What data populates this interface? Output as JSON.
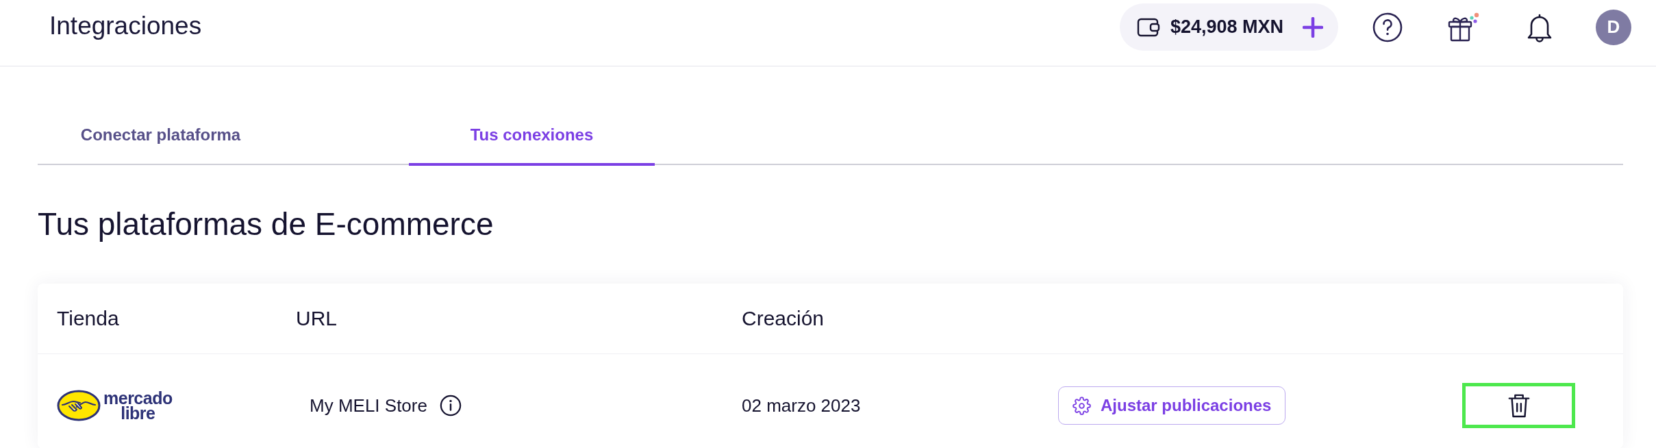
{
  "header": {
    "title": "Integraciones",
    "balance": {
      "amount": "$24,908 MXN"
    },
    "gift": {
      "has_news": true
    },
    "avatar": {
      "initial": "D"
    }
  },
  "tabs": [
    {
      "label": "Conectar plataforma",
      "selected": false
    },
    {
      "label": "Tus conexiones",
      "selected": true
    }
  ],
  "section": {
    "title": "Tus plataformas de E-commerce"
  },
  "table": {
    "columns": [
      "Tienda",
      "URL",
      "Creación"
    ],
    "rows": [
      {
        "logo_lines": [
          "mercado",
          "libre"
        ],
        "url": "My MELI Store",
        "created": "02 marzo 2023",
        "action": "Ajustar publicaciones",
        "delete_highlighted": true
      }
    ]
  }
}
